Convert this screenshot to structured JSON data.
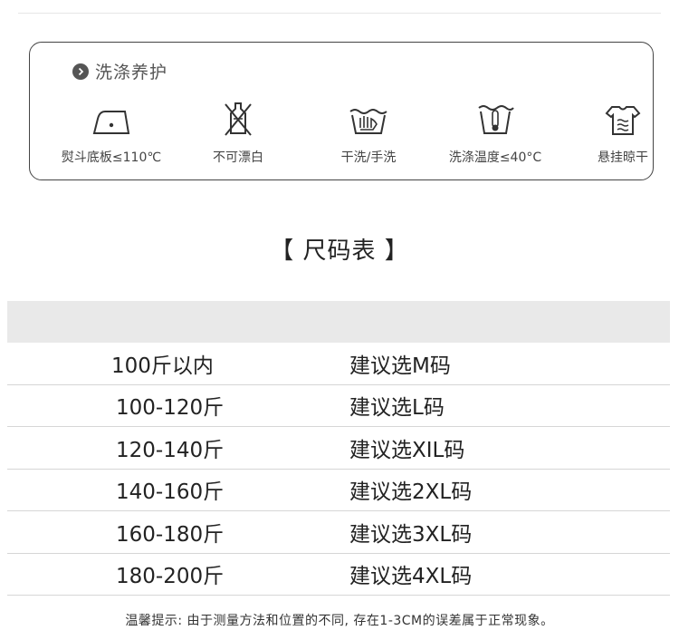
{
  "care": {
    "title": "洗涤养护",
    "items": [
      {
        "icon": "iron-low-temp-icon",
        "label": "熨斗底板≤110℃"
      },
      {
        "icon": "no-bleach-icon",
        "label": "不可漂白"
      },
      {
        "icon": "hand-wash-icon",
        "label": "干洗/手洗"
      },
      {
        "icon": "wash-temperature-icon",
        "label": "洗涤温度≤40°C"
      },
      {
        "icon": "hang-dry-icon",
        "label": "悬挂晾干"
      }
    ]
  },
  "size_chart": {
    "title": "【 尺码表 】",
    "rows": [
      {
        "weight": "100斤以内",
        "size": "建议选M码"
      },
      {
        "weight": "100-120斤",
        "size": "建议选L码"
      },
      {
        "weight": "120-140斤",
        "size": "建议选XIL码"
      },
      {
        "weight": "140-160斤",
        "size": "建议选2XL码"
      },
      {
        "weight": "160-180斤",
        "size": "建议选3XL码"
      },
      {
        "weight": "180-200斤",
        "size": "建议选4XL码"
      }
    ]
  },
  "footnote": "温馨提示: 由于测量方法和位置的不同, 存在1-3CM的误差属于正常现象。"
}
